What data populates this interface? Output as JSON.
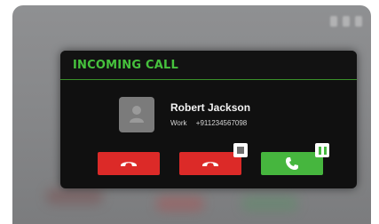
{
  "dialog": {
    "title": "INCOMING CALL"
  },
  "caller": {
    "name": "Robert Jackson",
    "type": "Work",
    "number": "+911234567098"
  },
  "actions": {
    "decline_icon": "phone-hangup-icon",
    "reject_icon": "phone-hangup-icon",
    "answer_icon": "phone-icon",
    "stop_badge_icon": "stop-icon",
    "pause_badge_icon": "pause-icon"
  },
  "colors": {
    "accent": "#46c23d",
    "decline": "#dc2a28",
    "answer": "#46b63e"
  }
}
